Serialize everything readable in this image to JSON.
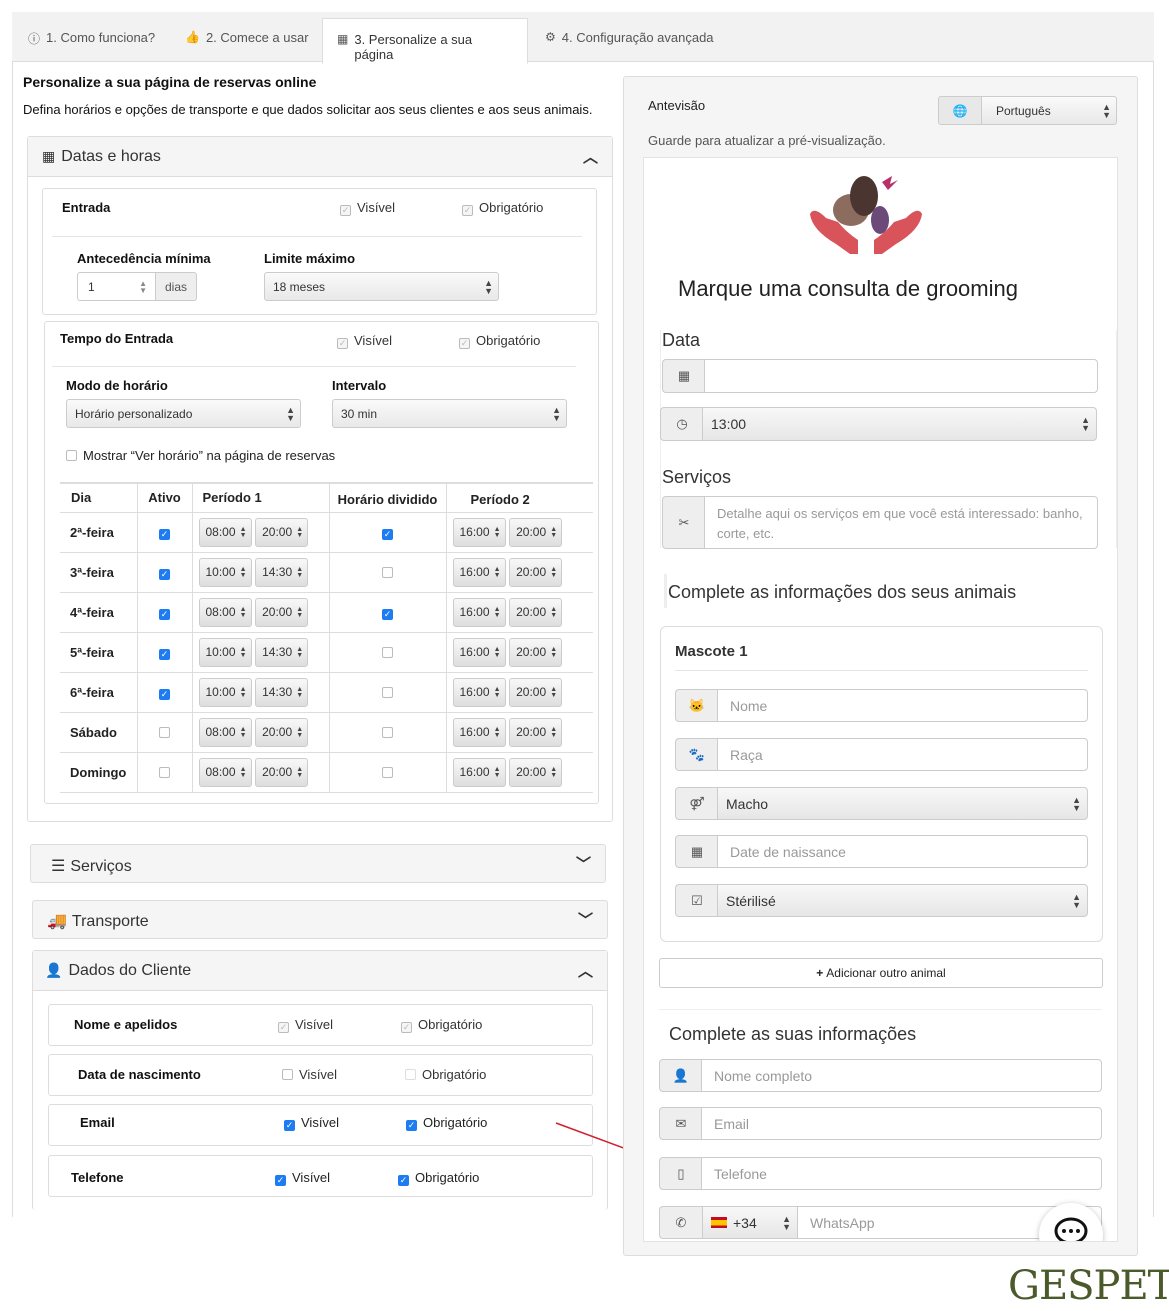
{
  "tabs": [
    {
      "label": "1. Como funciona?",
      "icon": "info-icon"
    },
    {
      "label": "2. Comece a usar",
      "icon": "thumbs-up-icon"
    },
    {
      "label": "3. Personalize a sua página",
      "icon": "calendar-page-icon"
    },
    {
      "label": "4. Configuração avançada",
      "icon": "gears-icon"
    }
  ],
  "main": {
    "title": "Personalize a sua página de reservas online",
    "subtitle": "Defina horários e opções de transporte e que dados solicitar aos seus clientes e aos seus animais."
  },
  "datas": {
    "header": "Datas e horas",
    "entrada_label": "Entrada",
    "visible": "Visível",
    "required": "Obrigatório",
    "antecedencia_label": "Antecedência mínima",
    "antecedencia_value": "1",
    "dias": "dias",
    "limite_label": "Limite máximo",
    "limite_value": "18 meses",
    "tempo_label": "Tempo do Entrada",
    "modo_label": "Modo de horário",
    "modo_value": "Horário personalizado",
    "intervalo_label": "Intervalo",
    "intervalo_value": "30 min",
    "mostrar_label": "Mostrar “Ver horário” na página de reservas",
    "schedule_headers": {
      "dia": "Dia",
      "ativo": "Ativo",
      "p1": "Período 1",
      "dividido": "Horário dividido",
      "p2": "Período 2"
    },
    "schedule": [
      {
        "dia": "2ª-feira",
        "ativo": true,
        "p1a": "08:00",
        "p1b": "20:00",
        "dividido": true,
        "p2a": "16:00",
        "p2b": "20:00"
      },
      {
        "dia": "3ª-feira",
        "ativo": true,
        "p1a": "10:00",
        "p1b": "14:30",
        "dividido": false,
        "p2a": "16:00",
        "p2b": "20:00"
      },
      {
        "dia": "4ª-feira",
        "ativo": true,
        "p1a": "08:00",
        "p1b": "20:00",
        "dividido": true,
        "p2a": "16:00",
        "p2b": "20:00"
      },
      {
        "dia": "5ª-feira",
        "ativo": true,
        "p1a": "10:00",
        "p1b": "14:30",
        "dividido": false,
        "p2a": "16:00",
        "p2b": "20:00"
      },
      {
        "dia": "6ª-feira",
        "ativo": true,
        "p1a": "10:00",
        "p1b": "14:30",
        "dividido": false,
        "p2a": "16:00",
        "p2b": "20:00"
      },
      {
        "dia": "Sábado",
        "ativo": false,
        "p1a": "08:00",
        "p1b": "20:00",
        "dividido": false,
        "p2a": "16:00",
        "p2b": "20:00"
      },
      {
        "dia": "Domingo",
        "ativo": false,
        "p1a": "08:00",
        "p1b": "20:00",
        "dividido": false,
        "p2a": "16:00",
        "p2b": "20:00"
      }
    ]
  },
  "servicos": {
    "header": "Serviços"
  },
  "transporte": {
    "header": "Transporte"
  },
  "cliente": {
    "header": "Dados do Cliente",
    "fields": [
      {
        "label": "Nome e apelidos",
        "visible": true,
        "required": true,
        "locked": true
      },
      {
        "label": "Data de nascimento",
        "visible": false,
        "required": false,
        "locked": false
      },
      {
        "label": "Email",
        "visible": true,
        "required": true,
        "locked": false
      },
      {
        "label": "Telefone",
        "visible": true,
        "required": true,
        "locked": false
      }
    ]
  },
  "preview": {
    "label": "Antevisão",
    "language": "Português",
    "hint": "Guarde para atualizar a pré-visualização.",
    "title": "Marque uma consulta de  grooming",
    "data_label": "Data",
    "time_value": "13:00",
    "servicos_label": "Serviços",
    "servicos_placeholder": "Detalhe aqui os serviços em que você está interessado: banho, corte, etc.",
    "animals_header": "Complete as informações dos seus animais",
    "pet_title": "Mascote 1",
    "pet_nome": "Nome",
    "pet_raca": "Raça",
    "pet_sexo": "Macho",
    "pet_nascimento": "Date de naissance",
    "pet_sterilise": "Stérilisé",
    "add_animal": "Adicionar outro animal",
    "info_header": "Complete as suas informações",
    "nome_completo": "Nome completo",
    "email": "Email",
    "telefone": "Telefone",
    "country_code": "+34",
    "whatsapp": "WhatsApp"
  },
  "brand": "GESPET",
  "colors": {
    "accent": "#1d7cf2",
    "annotation_line": "#d0202e",
    "brand": "#4b5a2a"
  }
}
